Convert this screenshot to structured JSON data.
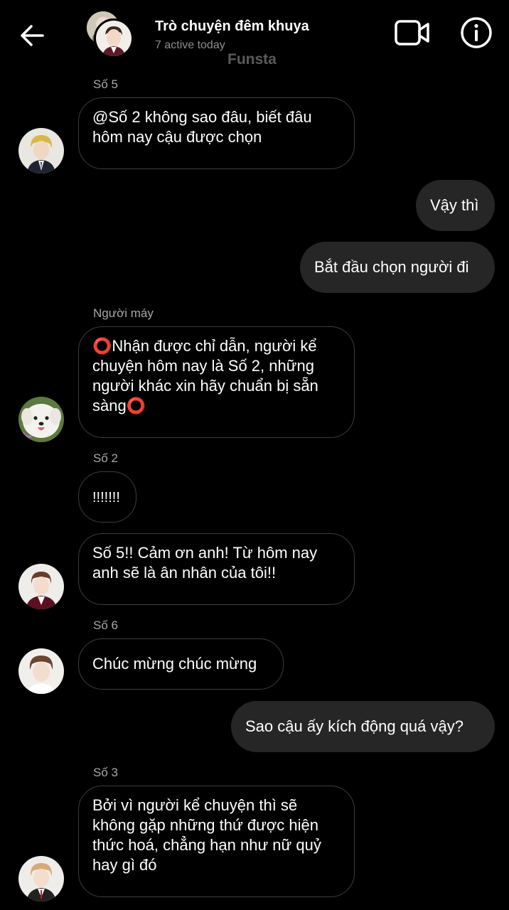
{
  "header": {
    "title": "Trò chuyện đêm khuya",
    "subtitle": "7 active today",
    "watermark": "Funsta"
  },
  "messages": [
    {
      "sender": "Số 5",
      "text": "@Số 2 không sao đâu, biết đâu\nhôm nay cậu được chọn"
    },
    {
      "sender": "",
      "text": "Vậy thì",
      "outgoing": true
    },
    {
      "sender": "",
      "text": "Bắt đầu chọn người đi",
      "outgoing": true
    },
    {
      "sender": "Người máy",
      "text": "⭕Nhận được chỉ dẫn, người kể\nchuyện hôm nay là Số 2, những\nngười khác xin hãy chuẩn bị sẵn\nsàng⭕"
    },
    {
      "sender": "Số 2",
      "text": "!!!!!!!"
    },
    {
      "sender": "",
      "text": "Số 5!! Cảm ơn anh! Từ hôm nay\nanh sẽ là ân nhân của tôi!!"
    },
    {
      "sender": "Số 6",
      "text": "Chúc mừng chúc mừng"
    },
    {
      "sender": "",
      "text": "Sao cậu ấy kích động quá vậy?",
      "outgoing": true
    },
    {
      "sender": "Số 3",
      "text": "Bởi vì người kể chuyện thì sẽ\nkhông gặp những thứ được hiện\nthức hoá, chẳng hạn như nữ quỷ\nhay gì đó"
    }
  ],
  "colors": {
    "background": "#000000",
    "outgoing_bubble": "#262626",
    "incoming_border": "#3d3d3d",
    "secondary_text": "#8e8e8e"
  },
  "icons": [
    "back-arrow-icon",
    "video-call-icon",
    "info-icon"
  ]
}
